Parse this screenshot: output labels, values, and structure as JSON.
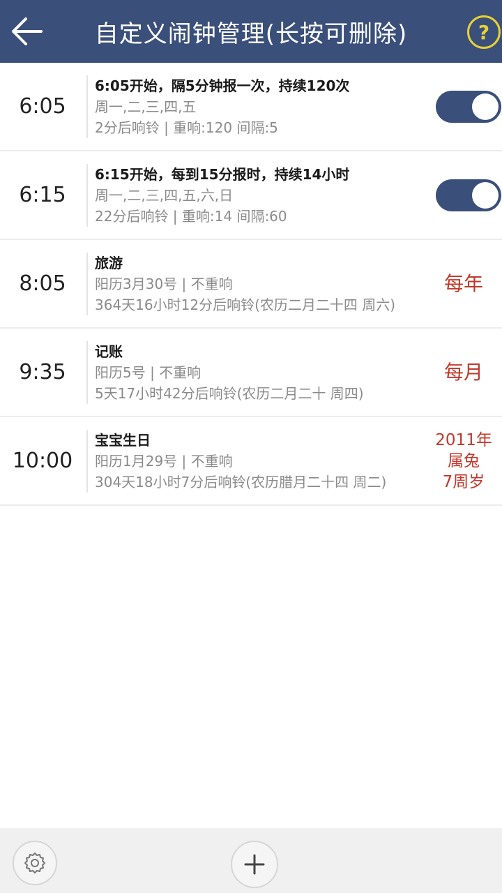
{
  "header": {
    "title": "自定义闹钟管理(长按可删除)",
    "back_icon": "arrow-left-icon",
    "help_label": "?",
    "bg_color": "#3a4f7a",
    "help_color": "#e6d233"
  },
  "alarms": [
    {
      "time": "6:05",
      "title": "6:05开始，隔5分钟报一次，持续120次",
      "line1": "周一,二,三,四,五",
      "line2": "2分后响铃 | 重响:120  间隔:5",
      "right_type": "toggle",
      "enabled": true
    },
    {
      "time": "6:15",
      "title": "6:15开始，每到15分报时，持续14小时",
      "line1": "周一,二,三,四,五,六,日",
      "line2": "22分后响铃 | 重响:14  间隔:60",
      "right_type": "toggle",
      "enabled": true
    },
    {
      "time": "8:05",
      "title": "旅游",
      "line1": "阳历3月30号 | 不重响",
      "line2": "364天16小时12分后响铃(农历二月二十四 周六)",
      "right_type": "label",
      "right_label": "每年"
    },
    {
      "time": "9:35",
      "title": "记账",
      "line1": "阳历5号 | 不重响",
      "line2": "5天17小时42分后响铃(农历二月二十 周四)",
      "right_type": "label",
      "right_label": "每月"
    },
    {
      "time": "10:00",
      "title": "宝宝生日",
      "line1": "阳历1月29号 | 不重响",
      "line2": "304天18小时7分后响铃(农历腊月二十四 周二)",
      "right_type": "multi",
      "right_lines": [
        "2011年",
        "属兔",
        "7周岁"
      ]
    }
  ],
  "bottom_bar": {
    "settings_icon": "gear-icon",
    "add_icon": "plus-icon"
  },
  "colors": {
    "accent": "#3a4f7a",
    "repeat_label": "#c0392b"
  }
}
